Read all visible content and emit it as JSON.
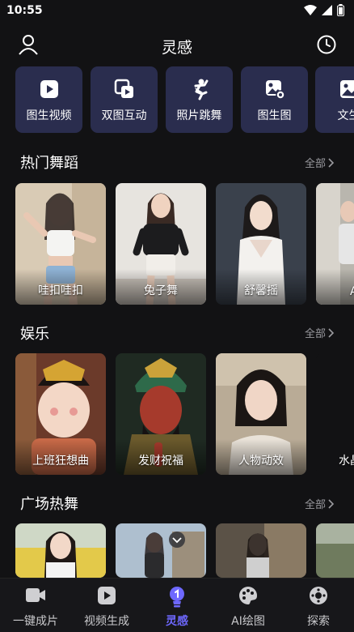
{
  "status": {
    "time": "10:55"
  },
  "header": {
    "title": "灵感"
  },
  "tools": [
    {
      "label": "图生视频",
      "icon": "image-to-video-icon"
    },
    {
      "label": "双图互动",
      "icon": "dual-image-icon"
    },
    {
      "label": "照片跳舞",
      "icon": "dancer-icon"
    },
    {
      "label": "图生图",
      "icon": "image-to-image-icon"
    },
    {
      "label": "文生",
      "icon": "text-to-image-icon"
    }
  ],
  "sections": {
    "dance": {
      "title": "热门舞蹈",
      "more": "全部",
      "items": [
        {
          "label": "哇扣哇扣"
        },
        {
          "label": "兔子舞"
        },
        {
          "label": "舒馨摇"
        },
        {
          "label": "A"
        }
      ]
    },
    "fun": {
      "title": "娱乐",
      "more": "全部",
      "items": [
        {
          "label": "上班狂想曲"
        },
        {
          "label": "发财祝福"
        },
        {
          "label": "人物动效"
        },
        {
          "label": "水晶"
        }
      ]
    },
    "plaza": {
      "title": "广场热舞",
      "more": "全部"
    }
  },
  "tabs": [
    {
      "label": "一键成片",
      "icon": "video-camera-icon"
    },
    {
      "label": "视频生成",
      "icon": "play-square-icon"
    },
    {
      "label": "灵感",
      "icon": "bulb-icon",
      "active": true
    },
    {
      "label": "AI绘图",
      "icon": "palette-icon"
    },
    {
      "label": "探索",
      "icon": "explore-icon"
    }
  ],
  "colors": {
    "accent": "#6e68ff",
    "tool_bg": "#2a2d4e",
    "background": "#121214"
  }
}
